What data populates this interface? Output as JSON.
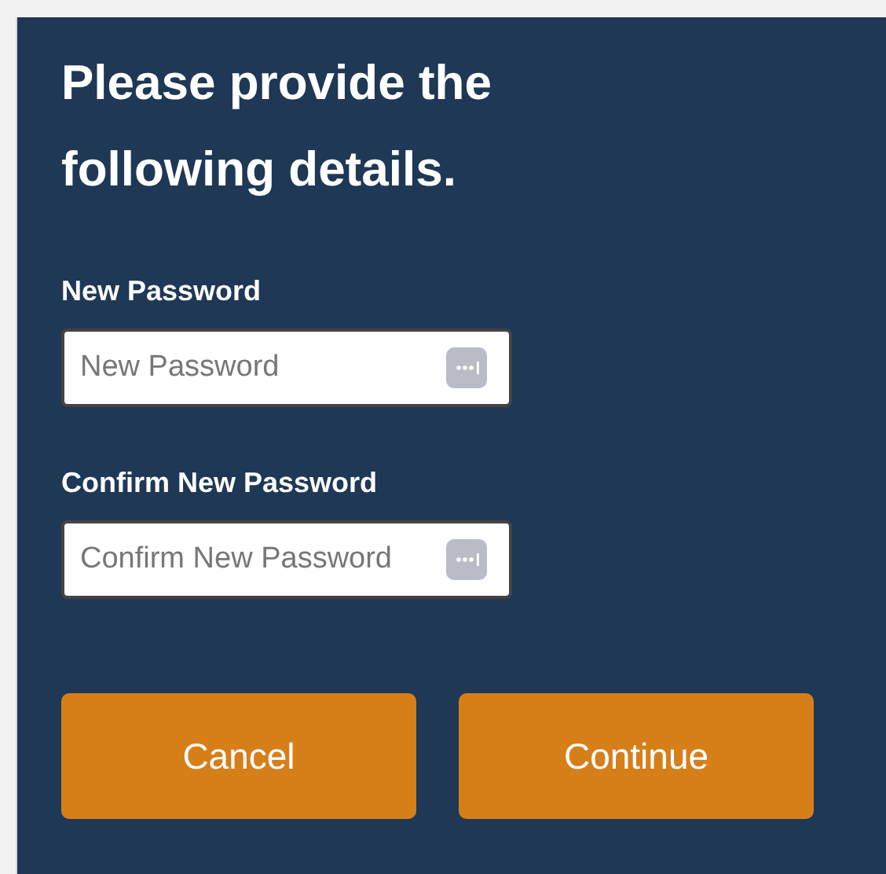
{
  "title": "Please provide the following details.",
  "fields": [
    {
      "label": "New Password",
      "placeholder": "New Password"
    },
    {
      "label": "Confirm New Password",
      "placeholder": "Confirm New Password"
    }
  ],
  "buttons": [
    "Cancel",
    "Continue"
  ]
}
